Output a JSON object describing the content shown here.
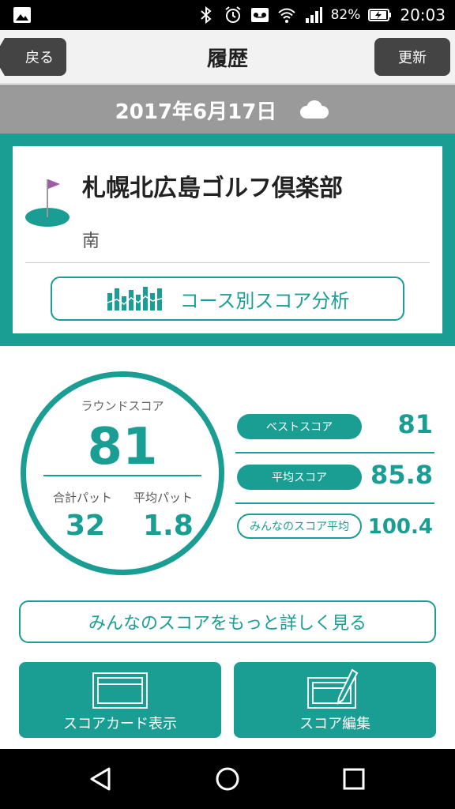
{
  "status": {
    "battery_percent": "82%",
    "time": "20:03",
    "icons": [
      "image-icon",
      "bluetooth-icon",
      "alarm-icon",
      "voicemail-icon",
      "wifi-icon",
      "signal-icon",
      "battery-charging-icon"
    ]
  },
  "header": {
    "back_label": "戻る",
    "title": "履歴",
    "update_label": "更新"
  },
  "date_bar": {
    "date": "2017年6月17日",
    "weather_icon": "cloud-icon"
  },
  "course": {
    "name": "札幌北広島ゴルフ倶楽部",
    "sub_course": "南",
    "analysis_button": "コース別スコア分析"
  },
  "round": {
    "round_score_label": "ラウンドスコア",
    "round_score": "81",
    "total_putts_label": "合計パット",
    "total_putts": "32",
    "avg_putts_label": "平均パット",
    "avg_putts": "1.8"
  },
  "stats": [
    {
      "label": "ベストスコア",
      "value": "81"
    },
    {
      "label": "平均スコア",
      "value": "85.8"
    },
    {
      "label": "みんなのスコア平均",
      "value": "100.4"
    }
  ],
  "actions": {
    "more_scores": "みんなのスコアをもっと詳しく見る",
    "scorecard": "スコアカード表示",
    "edit_score": "スコア編集"
  },
  "colors": {
    "accent": "#1a9e94",
    "header_button": "#444444",
    "date_bar": "#9a9a9a"
  }
}
